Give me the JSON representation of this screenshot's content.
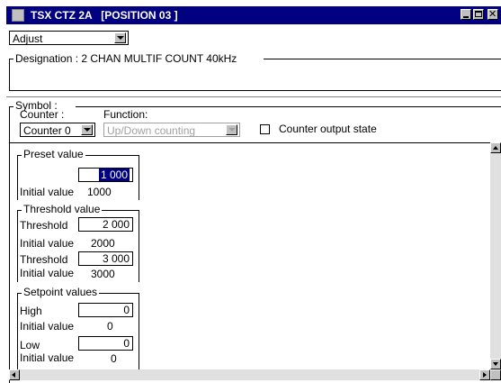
{
  "window": {
    "title": "TSX CTZ 2A   [POSITION 03 ]",
    "title_color": "#000080"
  },
  "mode_select": {
    "value": "Adjust"
  },
  "designation": {
    "text": "Designation : 2 CHAN MULTIF COUNT  40kHz"
  },
  "symbol": {
    "label": "Symbol :"
  },
  "counter": {
    "label": "Counter :",
    "value": "Counter 0"
  },
  "function": {
    "label": "Function:",
    "value": "Up/Down counting"
  },
  "counter_output": {
    "label": "Counter output state",
    "checked": false
  },
  "preset": {
    "title": "Preset value",
    "value": "1 000",
    "initial_label": "Initial value",
    "initial_value": "1000"
  },
  "threshold": {
    "title": "Threshold value",
    "t1_label": "Threshold",
    "t1_value": "2 000",
    "t1_initial_label": "Initial value",
    "t1_initial_value": "2000",
    "t2_label": "Threshold",
    "t2_value": "3 000",
    "t2_initial_label": "Initial value",
    "t2_initial_value": "3000"
  },
  "setpoint": {
    "title": "Setpoint values",
    "high_label": "High",
    "high_value": "0",
    "high_initial_label": "Initial value",
    "high_initial_value": "0",
    "low_label": "Low",
    "low_value": "0",
    "low_initial_label": "Initial value",
    "low_initial_value": "0"
  }
}
